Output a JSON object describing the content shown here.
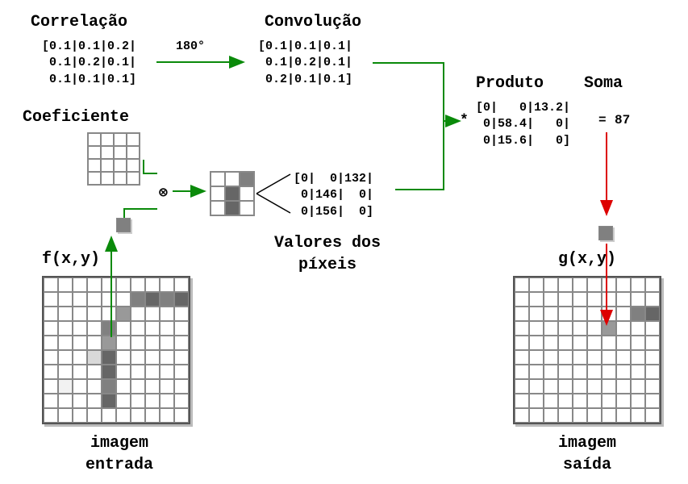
{
  "titles": {
    "correlacao": "Correlação",
    "convolucao": "Convolução",
    "coeficiente": "Coeficiente",
    "valores": "Valores dos\npíxeis",
    "produto": "Produto",
    "soma": "Soma",
    "fxy": "f(x,y)",
    "gxy": "g(x,y)",
    "img_in": "imagem\nentrada",
    "img_out": "imagem\nsaída",
    "rot": "180°"
  },
  "matrices": {
    "correlation": "[0.1|0.1|0.2|\n 0.1|0.2|0.1|\n 0.1|0.1|0.1]",
    "convolution": "[0.1|0.1|0.1|\n 0.1|0.2|0.1|\n 0.2|0.1|0.1]",
    "pixel_values": "[0|  0|132|\n 0|146|  0|\n 0|156|  0]",
    "product": "[0|   0|13.2|\n 0|58.4|   0|\n 0|15.6|   0]"
  },
  "symbols": {
    "tensor": "⊗",
    "star": "*",
    "equals": "=",
    "sum": "87"
  }
}
